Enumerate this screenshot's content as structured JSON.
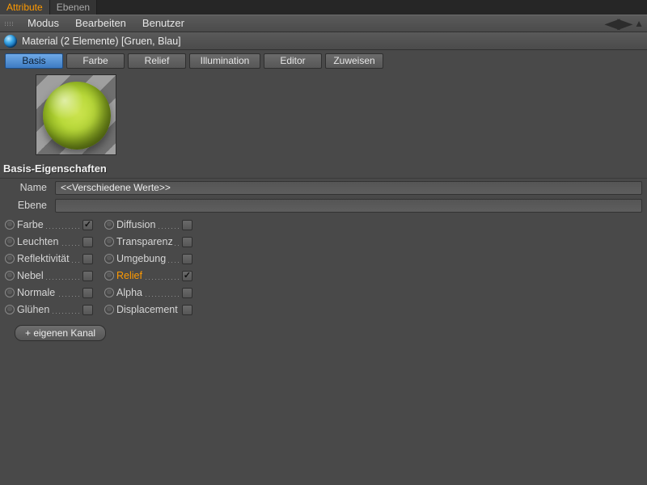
{
  "top_tabs": {
    "attribute": "Attribute",
    "ebenen": "Ebenen"
  },
  "menu": {
    "modus": "Modus",
    "bearbeiten": "Bearbeiten",
    "benutzer": "Benutzer"
  },
  "material": {
    "title": "Material (2 Elemente) [Gruen, Blau]"
  },
  "sub_tabs": {
    "basis": "Basis",
    "farbe": "Farbe",
    "relief": "Relief",
    "illumination": "Illumination",
    "editor": "Editor",
    "zuweisen": "Zuweisen"
  },
  "section": {
    "title": "Basis-Eigenschaften"
  },
  "form": {
    "name_label": "Name",
    "name_value": "<<Verschiedene Werte>>",
    "ebene_label": "Ebene",
    "ebene_value": ""
  },
  "channels": {
    "col1": [
      {
        "label": "Farbe",
        "checked": true
      },
      {
        "label": "Leuchten",
        "checked": false
      },
      {
        "label": "Reflektivität",
        "checked": false
      },
      {
        "label": "Nebel",
        "checked": false
      },
      {
        "label": "Normale",
        "checked": false
      },
      {
        "label": "Glühen",
        "checked": false
      }
    ],
    "col2": [
      {
        "label": "Diffusion",
        "checked": false
      },
      {
        "label": "Transparenz",
        "checked": false
      },
      {
        "label": "Umgebung",
        "checked": false
      },
      {
        "label": "Relief",
        "checked": true,
        "highlight": true
      },
      {
        "label": "Alpha",
        "checked": false
      },
      {
        "label": "Displacement",
        "checked": false
      }
    ]
  },
  "buttons": {
    "add_channel": "+ eigenen Kanal"
  }
}
